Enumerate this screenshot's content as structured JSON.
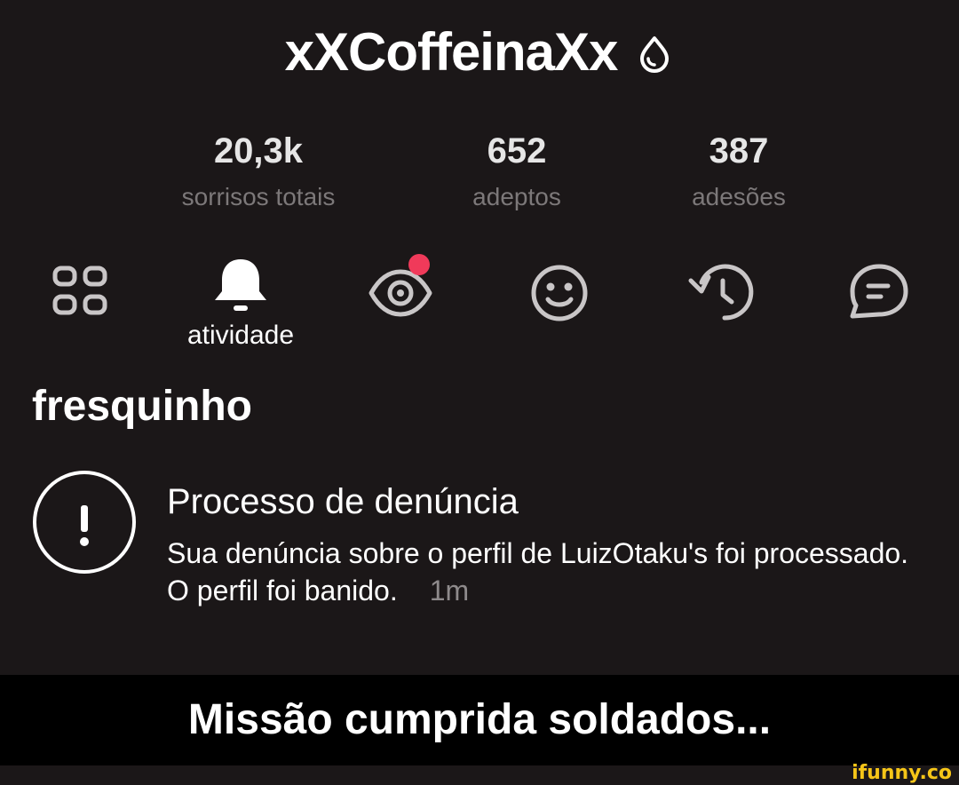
{
  "profile": {
    "username": "xXCoffeinaXx",
    "badge_icon": "water-drop-icon"
  },
  "stats": [
    {
      "value": "20,3k",
      "label": "sorrisos totais"
    },
    {
      "value": "652",
      "label": "adeptos"
    },
    {
      "value": "387",
      "label": "adesões"
    }
  ],
  "tabs": {
    "active_label": "atividade",
    "icons": [
      "grid-icon",
      "bell-icon",
      "eye-icon",
      "smiley-icon",
      "history-icon",
      "chat-icon"
    ],
    "badge_color": "#f03a5a"
  },
  "section": {
    "title": "fresquinho"
  },
  "notification": {
    "icon": "alert-circle-icon",
    "title": "Processo de denúncia",
    "body": "Sua denúncia sobre o perfil de LuizOtaku's foi processado. O perfil foi banido.",
    "time": "1m"
  },
  "caption": "Missão cumprida soldados...",
  "watermark": "ifunny.co",
  "colors": {
    "background": "#1b1718",
    "caption_background": "#000000",
    "muted_text": "#7c7879",
    "icon_gray": "#c9c6c7",
    "watermark": "#f5c518"
  }
}
